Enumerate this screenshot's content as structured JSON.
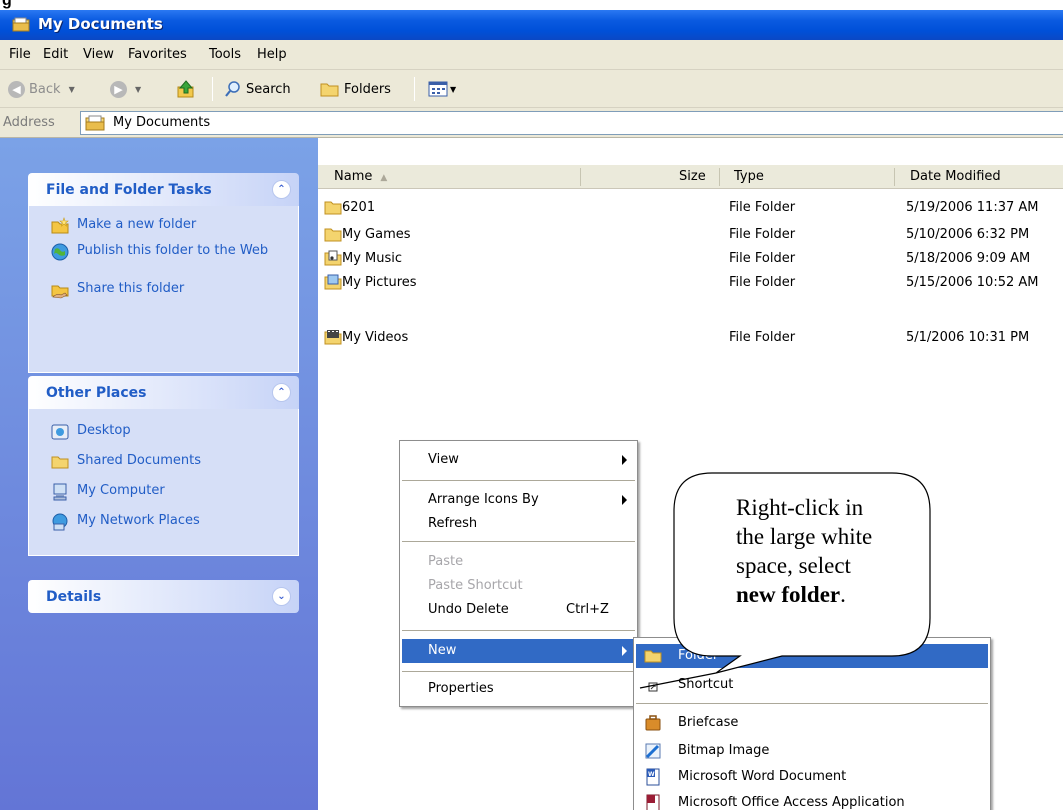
{
  "window": {
    "title": "My Documents"
  },
  "menubar": [
    "File",
    "Edit",
    "View",
    "Favorites",
    "Tools",
    "Help"
  ],
  "toolbar": {
    "back_label": "Back",
    "search_label": "Search",
    "folders_label": "Folders"
  },
  "address": {
    "label": "Address",
    "value": "My Documents"
  },
  "file_tasks": {
    "title": "File and Folder Tasks",
    "items": [
      {
        "label": "Make a new folder",
        "icon": "new-folder-icon"
      },
      {
        "label": "Publish this folder to the Web",
        "icon": "publish-web-icon"
      },
      {
        "label": "Share this folder",
        "icon": "share-folder-icon"
      }
    ]
  },
  "other_places": {
    "title": "Other Places",
    "items": [
      {
        "label": "Desktop",
        "icon": "desktop-icon"
      },
      {
        "label": "Shared Documents",
        "icon": "folder-icon"
      },
      {
        "label": "My Computer",
        "icon": "computer-icon"
      },
      {
        "label": "My Network Places",
        "icon": "network-icon"
      }
    ]
  },
  "details": {
    "title": "Details"
  },
  "columns": {
    "name": "Name",
    "size": "Size",
    "type": "Type",
    "date": "Date Modified"
  },
  "files": [
    {
      "name": "6201",
      "type": "File Folder",
      "date": "5/19/2006 11:37 AM"
    },
    {
      "name": "My Games",
      "type": "File Folder",
      "date": "5/10/2006 6:32 PM"
    },
    {
      "name": "My Music",
      "type": "File Folder",
      "date": "5/18/2006 9:09 AM"
    },
    {
      "name": "My Pictures",
      "type": "File Folder",
      "date": "5/15/2006 10:52 AM"
    },
    {
      "name": "My Videos",
      "type": "File Folder",
      "date": "5/1/2006 10:31 PM"
    }
  ],
  "context_menu": {
    "view": "View",
    "arrange": "Arrange Icons By",
    "refresh": "Refresh",
    "paste": "Paste",
    "paste_shortcut": "Paste Shortcut",
    "undo": "Undo Delete",
    "undo_shortcut": "Ctrl+Z",
    "new": "New",
    "properties": "Properties"
  },
  "new_submenu": {
    "folder": "Folder",
    "shortcut": "Shortcut",
    "briefcase": "Briefcase",
    "bitmap": "Bitmap Image",
    "word": "Microsoft Word Document",
    "access": "Microsoft Office Access Application"
  },
  "callout": {
    "line1": "Right-click in",
    "line2": "the large white",
    "line3": "space, select",
    "bold": "new folder",
    "end": "."
  },
  "colors": {
    "titlebar": "#0050d8",
    "selection": "#316ac5",
    "task_link": "#215dc6",
    "task_pane": "#6375d6"
  }
}
